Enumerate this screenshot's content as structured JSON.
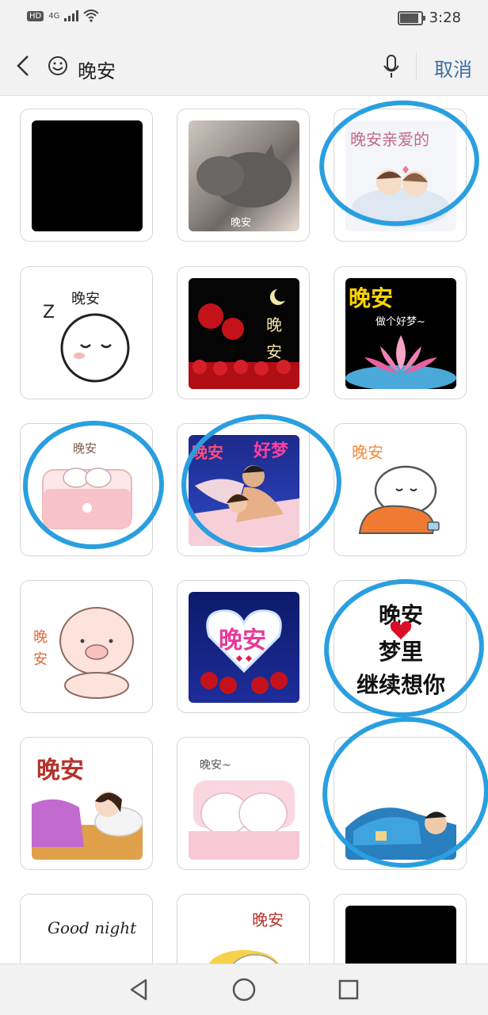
{
  "status_bar": {
    "network_badge": "HD",
    "network_type": "4G",
    "time": "3:28",
    "battery_level": 0.85
  },
  "search_bar": {
    "back_icon": "chevron-left-icon",
    "emoji_icon": "smiley-icon",
    "query": "晚安",
    "mic_icon": "mic-icon",
    "cancel_label": "取消"
  },
  "stickers": [
    {
      "caption": ""
    },
    {
      "caption": "晚安"
    },
    {
      "caption": "晚安亲爱的"
    },
    {
      "caption": "晚安"
    },
    {
      "caption": "晚安"
    },
    {
      "caption": "晚安",
      "sub": "做个好梦~"
    },
    {
      "caption": "晚安"
    },
    {
      "caption": "晚安",
      "sub": "好梦"
    },
    {
      "caption": "晚安"
    },
    {
      "caption": "晚安"
    },
    {
      "caption": "晚安"
    },
    {
      "caption": "晚安",
      "line2": "梦里",
      "line3": "继续想你"
    },
    {
      "caption": "晚安"
    },
    {
      "caption": "晚安~"
    },
    {
      "caption": ""
    },
    {
      "caption": "Good night"
    },
    {
      "caption": "晚安"
    },
    {
      "caption": ""
    }
  ],
  "nav_bar": {
    "back_icon": "triangle-back-icon",
    "home_icon": "circle-home-icon",
    "recents_icon": "square-recents-icon"
  },
  "annotation_color": "#2a9fe0"
}
